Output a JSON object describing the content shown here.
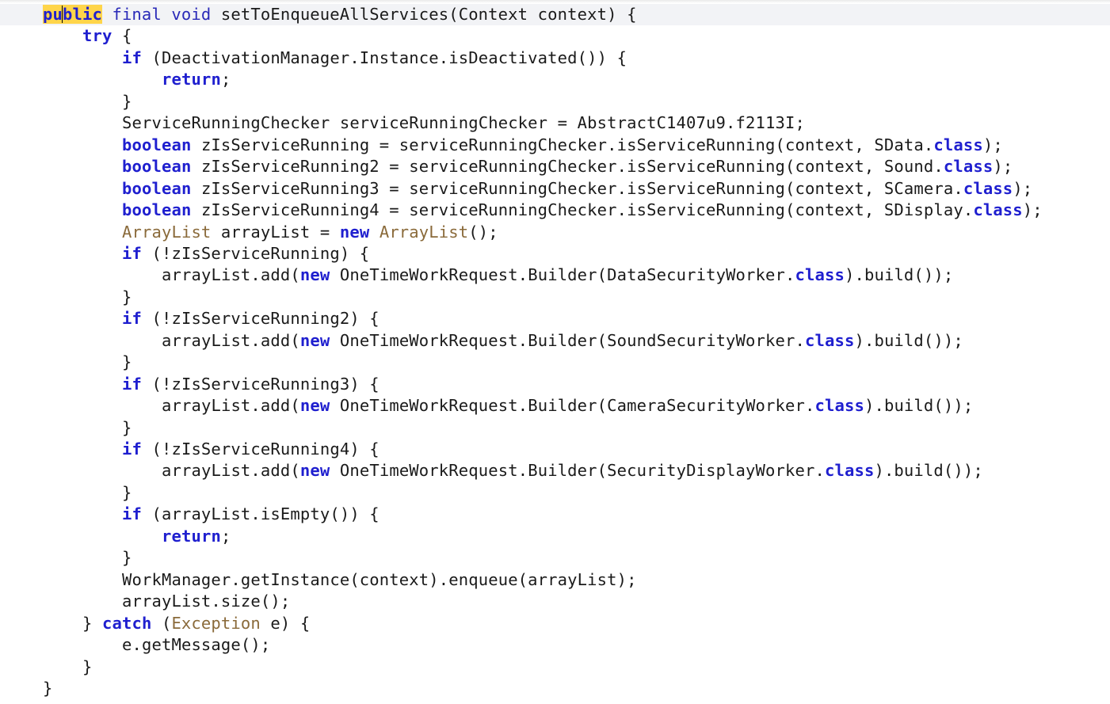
{
  "editor": {
    "lines": [
      {
        "indent": 0,
        "current": true,
        "tokens": [
          {
            "t": "pu",
            "c": "hl"
          },
          {
            "caret": true
          },
          {
            "t": "blic",
            "c": "hl"
          },
          {
            "t": " ",
            "c": "pl"
          },
          {
            "t": "final",
            "c": "kwc"
          },
          {
            "t": " ",
            "c": "pl"
          },
          {
            "t": "void",
            "c": "kwc"
          },
          {
            "t": " setToEnqueueAllServices(",
            "c": "pl"
          },
          {
            "t": "Context",
            "c": "pl"
          },
          {
            "t": " context) {",
            "c": "pl"
          }
        ]
      },
      {
        "indent": 1,
        "tokens": [
          {
            "t": "try",
            "c": "kw"
          },
          {
            "t": " {",
            "c": "pl"
          }
        ]
      },
      {
        "indent": 2,
        "tokens": [
          {
            "t": "if",
            "c": "kw"
          },
          {
            "t": " (DeactivationManager.Instance.isDeactivated()) {",
            "c": "pl"
          }
        ]
      },
      {
        "indent": 3,
        "tokens": [
          {
            "t": "return",
            "c": "kw"
          },
          {
            "t": ";",
            "c": "pl"
          }
        ]
      },
      {
        "indent": 2,
        "tokens": [
          {
            "t": "}",
            "c": "pl"
          }
        ]
      },
      {
        "indent": 2,
        "tokens": [
          {
            "t": "ServiceRunningChecker serviceRunningChecker = AbstractC1407u9.f2113I;",
            "c": "pl"
          }
        ]
      },
      {
        "indent": 2,
        "tokens": [
          {
            "t": "boolean",
            "c": "kw"
          },
          {
            "t": " zIsServiceRunning = serviceRunningChecker.isServiceRunning(context, SData.",
            "c": "pl"
          },
          {
            "t": "class",
            "c": "kw"
          },
          {
            "t": ");",
            "c": "pl"
          }
        ]
      },
      {
        "indent": 2,
        "tokens": [
          {
            "t": "boolean",
            "c": "kw"
          },
          {
            "t": " zIsServiceRunning2 = serviceRunningChecker.isServiceRunning(context, Sound.",
            "c": "pl"
          },
          {
            "t": "class",
            "c": "kw"
          },
          {
            "t": ");",
            "c": "pl"
          }
        ]
      },
      {
        "indent": 2,
        "tokens": [
          {
            "t": "boolean",
            "c": "kw"
          },
          {
            "t": " zIsServiceRunning3 = serviceRunningChecker.isServiceRunning(context, SCamera.",
            "c": "pl"
          },
          {
            "t": "class",
            "c": "kw"
          },
          {
            "t": ");",
            "c": "pl"
          }
        ]
      },
      {
        "indent": 2,
        "tokens": [
          {
            "t": "boolean",
            "c": "kw"
          },
          {
            "t": " zIsServiceRunning4 = serviceRunningChecker.isServiceRunning(context, SDisplay.",
            "c": "pl"
          },
          {
            "t": "class",
            "c": "kw"
          },
          {
            "t": ");",
            "c": "pl"
          }
        ]
      },
      {
        "indent": 2,
        "tokens": [
          {
            "t": "ArrayList",
            "c": "ty"
          },
          {
            "t": " arrayList = ",
            "c": "pl"
          },
          {
            "t": "new",
            "c": "kw"
          },
          {
            "t": " ",
            "c": "pl"
          },
          {
            "t": "ArrayList",
            "c": "ty"
          },
          {
            "t": "();",
            "c": "pl"
          }
        ]
      },
      {
        "indent": 2,
        "tokens": [
          {
            "t": "if",
            "c": "kw"
          },
          {
            "t": " (!zIsServiceRunning) {",
            "c": "pl"
          }
        ]
      },
      {
        "indent": 3,
        "tokens": [
          {
            "t": "arrayList.add(",
            "c": "pl"
          },
          {
            "t": "new",
            "c": "kw"
          },
          {
            "t": " OneTimeWorkRequest.Builder(DataSecurityWorker.",
            "c": "pl"
          },
          {
            "t": "class",
            "c": "kw"
          },
          {
            "t": ").build());",
            "c": "pl"
          }
        ]
      },
      {
        "indent": 2,
        "tokens": [
          {
            "t": "}",
            "c": "pl"
          }
        ]
      },
      {
        "indent": 2,
        "tokens": [
          {
            "t": "if",
            "c": "kw"
          },
          {
            "t": " (!zIsServiceRunning2) {",
            "c": "pl"
          }
        ]
      },
      {
        "indent": 3,
        "tokens": [
          {
            "t": "arrayList.add(",
            "c": "pl"
          },
          {
            "t": "new",
            "c": "kw"
          },
          {
            "t": " OneTimeWorkRequest.Builder(SoundSecurityWorker.",
            "c": "pl"
          },
          {
            "t": "class",
            "c": "kw"
          },
          {
            "t": ").build());",
            "c": "pl"
          }
        ]
      },
      {
        "indent": 2,
        "tokens": [
          {
            "t": "}",
            "c": "pl"
          }
        ]
      },
      {
        "indent": 2,
        "tokens": [
          {
            "t": "if",
            "c": "kw"
          },
          {
            "t": " (!zIsServiceRunning3) {",
            "c": "pl"
          }
        ]
      },
      {
        "indent": 3,
        "tokens": [
          {
            "t": "arrayList.add(",
            "c": "pl"
          },
          {
            "t": "new",
            "c": "kw"
          },
          {
            "t": " OneTimeWorkRequest.Builder(CameraSecurityWorker.",
            "c": "pl"
          },
          {
            "t": "class",
            "c": "kw"
          },
          {
            "t": ").build());",
            "c": "pl"
          }
        ]
      },
      {
        "indent": 2,
        "tokens": [
          {
            "t": "}",
            "c": "pl"
          }
        ]
      },
      {
        "indent": 2,
        "tokens": [
          {
            "t": "if",
            "c": "kw"
          },
          {
            "t": " (!zIsServiceRunning4) {",
            "c": "pl"
          }
        ]
      },
      {
        "indent": 3,
        "tokens": [
          {
            "t": "arrayList.add(",
            "c": "pl"
          },
          {
            "t": "new",
            "c": "kw"
          },
          {
            "t": " OneTimeWorkRequest.Builder(SecurityDisplayWorker.",
            "c": "pl"
          },
          {
            "t": "class",
            "c": "kw"
          },
          {
            "t": ").build());",
            "c": "pl"
          }
        ]
      },
      {
        "indent": 2,
        "tokens": [
          {
            "t": "}",
            "c": "pl"
          }
        ]
      },
      {
        "indent": 2,
        "tokens": [
          {
            "t": "if",
            "c": "kw"
          },
          {
            "t": " (arrayList.isEmpty()) {",
            "c": "pl"
          }
        ]
      },
      {
        "indent": 3,
        "tokens": [
          {
            "t": "return",
            "c": "kw"
          },
          {
            "t": ";",
            "c": "pl"
          }
        ]
      },
      {
        "indent": 2,
        "tokens": [
          {
            "t": "}",
            "c": "pl"
          }
        ]
      },
      {
        "indent": 2,
        "tokens": [
          {
            "t": "WorkManager.getInstance(context).enqueue(arrayList);",
            "c": "pl"
          }
        ]
      },
      {
        "indent": 2,
        "tokens": [
          {
            "t": "arrayList.size();",
            "c": "pl"
          }
        ]
      },
      {
        "indent": 1,
        "tokens": [
          {
            "t": "} ",
            "c": "pl"
          },
          {
            "t": "catch",
            "c": "kw"
          },
          {
            "t": " (",
            "c": "pl"
          },
          {
            "t": "Exception",
            "c": "ty"
          },
          {
            "t": " e) {",
            "c": "pl"
          }
        ]
      },
      {
        "indent": 2,
        "tokens": [
          {
            "t": "e.getMessage();",
            "c": "pl"
          }
        ]
      },
      {
        "indent": 1,
        "tokens": [
          {
            "t": "}",
            "c": "pl"
          }
        ]
      },
      {
        "indent": 0,
        "tokens": [
          {
            "t": "}",
            "c": "pl"
          }
        ]
      }
    ]
  }
}
